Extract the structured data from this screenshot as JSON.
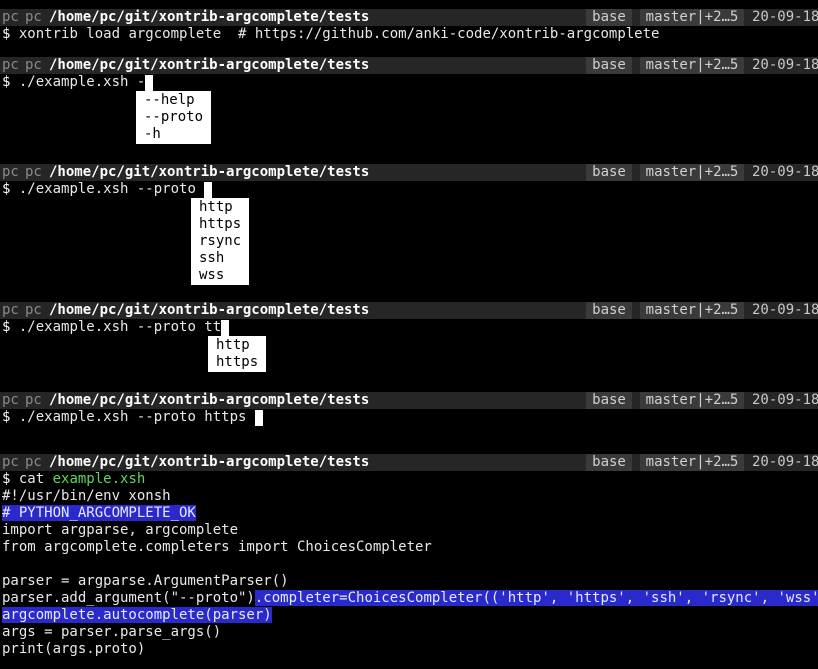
{
  "colors": {
    "background": "#000000",
    "bar": "#262626",
    "pill": "#3a3a3a",
    "menu_bg": "#ffffff",
    "highlight": "#2a2acc",
    "filename_green": "#5fd75f"
  },
  "prompt_bar": {
    "user": "pc",
    "host": "pc",
    "path": "/home/pc/git/xontrib-argcomplete/tests",
    "env": "base",
    "branch": "master|+2…5",
    "date": "20-09-18",
    "prompt_symbol": "$"
  },
  "blocks": [
    {
      "command": "xontrib load argcomplete  # https://github.com/anki-code/xontrib-argcomplete"
    },
    {
      "command": "./example.xsh -",
      "menu": [
        "--help",
        "--proto",
        "-h"
      ]
    },
    {
      "command": "./example.xsh --proto ",
      "menu": [
        "http",
        "https",
        "rsync",
        "ssh",
        "wss"
      ]
    },
    {
      "command": "./example.xsh --proto tt",
      "menu": [
        "http",
        "https"
      ]
    },
    {
      "command": "./example.xsh --proto https "
    },
    {
      "command_prefix": "cat ",
      "command_file": "example.xsh"
    }
  ],
  "file_content": {
    "shebang": "#!/usr/bin/env xonsh",
    "marker": "# PYTHON_ARGCOMPLETE_OK",
    "import1": "import argparse, argcomplete",
    "import2": "from argcomplete.completers import ChoicesCompleter",
    "blank": "",
    "parser": "parser = argparse.ArgumentParser()",
    "add_arg_plain": "parser.add_argument(\"--proto\")",
    "add_arg_highlight": ".completer=ChoicesCompleter(('http', 'https', 'ssh', 'rsync', 'wss'))",
    "autocomplete": "argcomplete.autocomplete(parser)",
    "parse_args": "args = parser.parse_args()",
    "print": "print(args.proto)"
  }
}
